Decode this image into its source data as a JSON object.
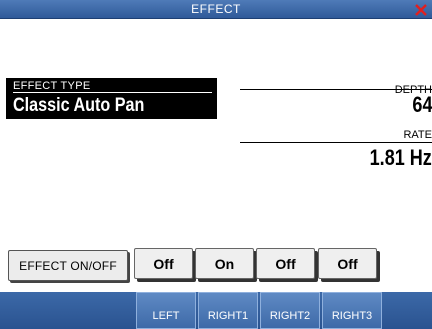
{
  "window": {
    "title": "EFFECT",
    "close_icon": "close-icon",
    "accent": "#e02020"
  },
  "effect_type": {
    "label": "EFFECT TYPE",
    "value": "Classic Auto Pan"
  },
  "params": {
    "depth": {
      "label": "DEPTH",
      "value": "64"
    },
    "rate": {
      "label": "RATE",
      "value": "1.81 Hz"
    }
  },
  "effect_onoff": {
    "label": "EFFECT ON/OFF",
    "parts": [
      {
        "name": "LEFT",
        "state": "Off"
      },
      {
        "name": "RIGHT1",
        "state": "On"
      },
      {
        "name": "RIGHT2",
        "state": "Off"
      },
      {
        "name": "RIGHT3",
        "state": "Off"
      }
    ]
  },
  "tabs": [
    "LEFT",
    "RIGHT1",
    "RIGHT2",
    "RIGHT3"
  ]
}
